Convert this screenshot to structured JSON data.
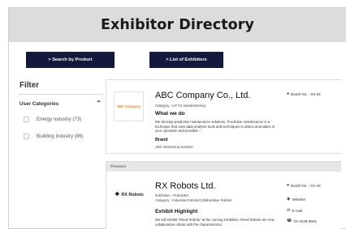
{
  "header": {
    "title": "Exhibitor Directory"
  },
  "tabs": [
    {
      "label": "> Search by Product"
    },
    {
      "label": "> List of Exhibitors"
    }
  ],
  "sidebar": {
    "title": "Filter",
    "category_heading": "User Categories",
    "categories": [
      {
        "label": "Energy Industry (73)"
      },
      {
        "label": "Building Industry (86)"
      }
    ]
  },
  "exhibitors": [
    {
      "logo_text": "ABC Company",
      "name": "ABC Company Co., Ltd.",
      "category": "Category : IoT for manufacturing",
      "section_title": "What we do",
      "description": "We develop predictive maintenance solutions.  Predictive maintenance is a technique that uses data analysis tools and techniques to detect anomalies in your operation and possible ···",
      "brand_title": "Brand",
      "brand": "ABC Monitoring Solution",
      "booth": "Booth No. : S6-25"
    },
    {
      "badge": "Premium",
      "logo_text": "RX Robots",
      "name": "RX Robots Ltd.",
      "exhibition": "Exhibition : RoboDEX",
      "category": "Category : Industrial Robots/Collaborative Robots",
      "section_title": "Exhibit Highlight",
      "description": "We will exhibit \"Reed Robots\" at the coming exhibition. Reed Robots are new collaborative robots with the characteristics",
      "booth": "Booth No. : S2-46",
      "website": "Website",
      "email": "E-mail",
      "phone": "03-3349-8501"
    }
  ]
}
